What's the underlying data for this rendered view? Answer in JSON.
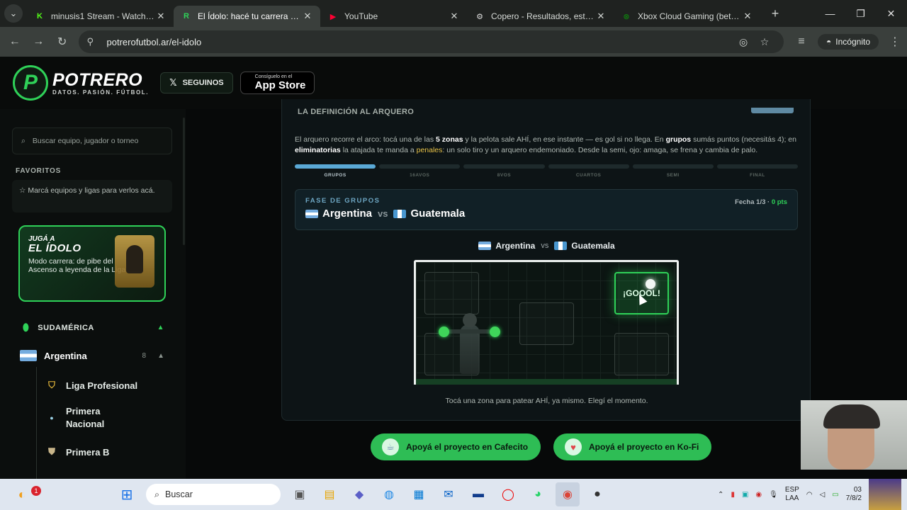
{
  "browser": {
    "tabs": [
      {
        "title": "minusis1 Stream - Watch Li...",
        "favicon": "K",
        "favicon_color": "#53fc18"
      },
      {
        "title": "El Ídolo: hacé tu carrera en l...",
        "favicon": "R",
        "favicon_color": "#2fd158"
      },
      {
        "title": "YouTube",
        "favicon": "▶",
        "favicon_color": "#ff0033"
      },
      {
        "title": "Copero - Resultados, estadi...",
        "favicon": "⚙",
        "favicon_color": "#dddddd"
      },
      {
        "title": "Xbox Cloud Gaming (beta) e...",
        "favicon": "⊗",
        "favicon_color": "#107c10"
      }
    ],
    "active_tab": 1,
    "url": "potrerofutbol.ar/el-idolo",
    "incognito_label": "Incógnito"
  },
  "site": {
    "brand": "POTRERO",
    "tagline": "DATOS. PASIÓN. FÚTBOL.",
    "follow_label": "SEGUINOS",
    "appstore_small": "Consíguelo en el",
    "appstore_big": "App Store",
    "accent": "#2fd158"
  },
  "sidebar": {
    "search_placeholder": "Buscar equipo, jugador o torneo",
    "favorites_title": "FAVORITOS",
    "favorites_hint": "Marcá equipos y ligas para verlos acá.",
    "promo": {
      "line1": "JUGÁ A",
      "line2": "EL ÍDOLO",
      "line3": "Modo carrera: de pibe del Ascenso a leyenda de la Liga"
    },
    "region": "SUDAMÉRICA",
    "country": {
      "name": "Argentina",
      "count": "8"
    },
    "leagues": [
      "Liga Profesional",
      "Primera Nacional",
      "Primera B"
    ]
  },
  "panel": {
    "title": "LA DEFINICIÓN AL ARQUERO",
    "description": {
      "p1": "El arquero recorre el arco: tocá una de las ",
      "b1": "5 zonas",
      "p2": " y la pelota sale AHÍ, en ese instante — es gol si no llega. En ",
      "b2": "grupos",
      "p3": " sumás puntos (necesitás 4); en ",
      "b3": "eliminatorias",
      "p4": " la atajada te manda a ",
      "hl": "penales",
      "p5": ": un solo tiro y un arquero endemoniado. Desde la semi, ojo: amaga, se frena y cambia de palo."
    },
    "stages": [
      "GRUPOS",
      "16AVOS",
      "8VOS",
      "CUARTOS",
      "SEMI",
      "FINAL"
    ],
    "current_stage": 0,
    "match": {
      "phase": "FASE DE GRUPOS",
      "home": "Argentina",
      "vs": "vs",
      "away": "Guatemala",
      "fecha": "Fecha 1/3 · ",
      "pts": "0 pts"
    },
    "goal_label": "¡GOOOL!",
    "hint": "Tocá una zona para patear AHÍ, ya mismo. Elegí el momento."
  },
  "support": {
    "cafecito": "Apoyá el proyecto en Cafecito",
    "kofi": "Apoyá el proyecto en Ko-Fi"
  },
  "taskbar": {
    "search_placeholder": "Buscar",
    "notification_count": "1",
    "lang_top": "ESP",
    "lang_bottom": "LAA",
    "clock_time": "03",
    "clock_date": "7/8/2"
  }
}
